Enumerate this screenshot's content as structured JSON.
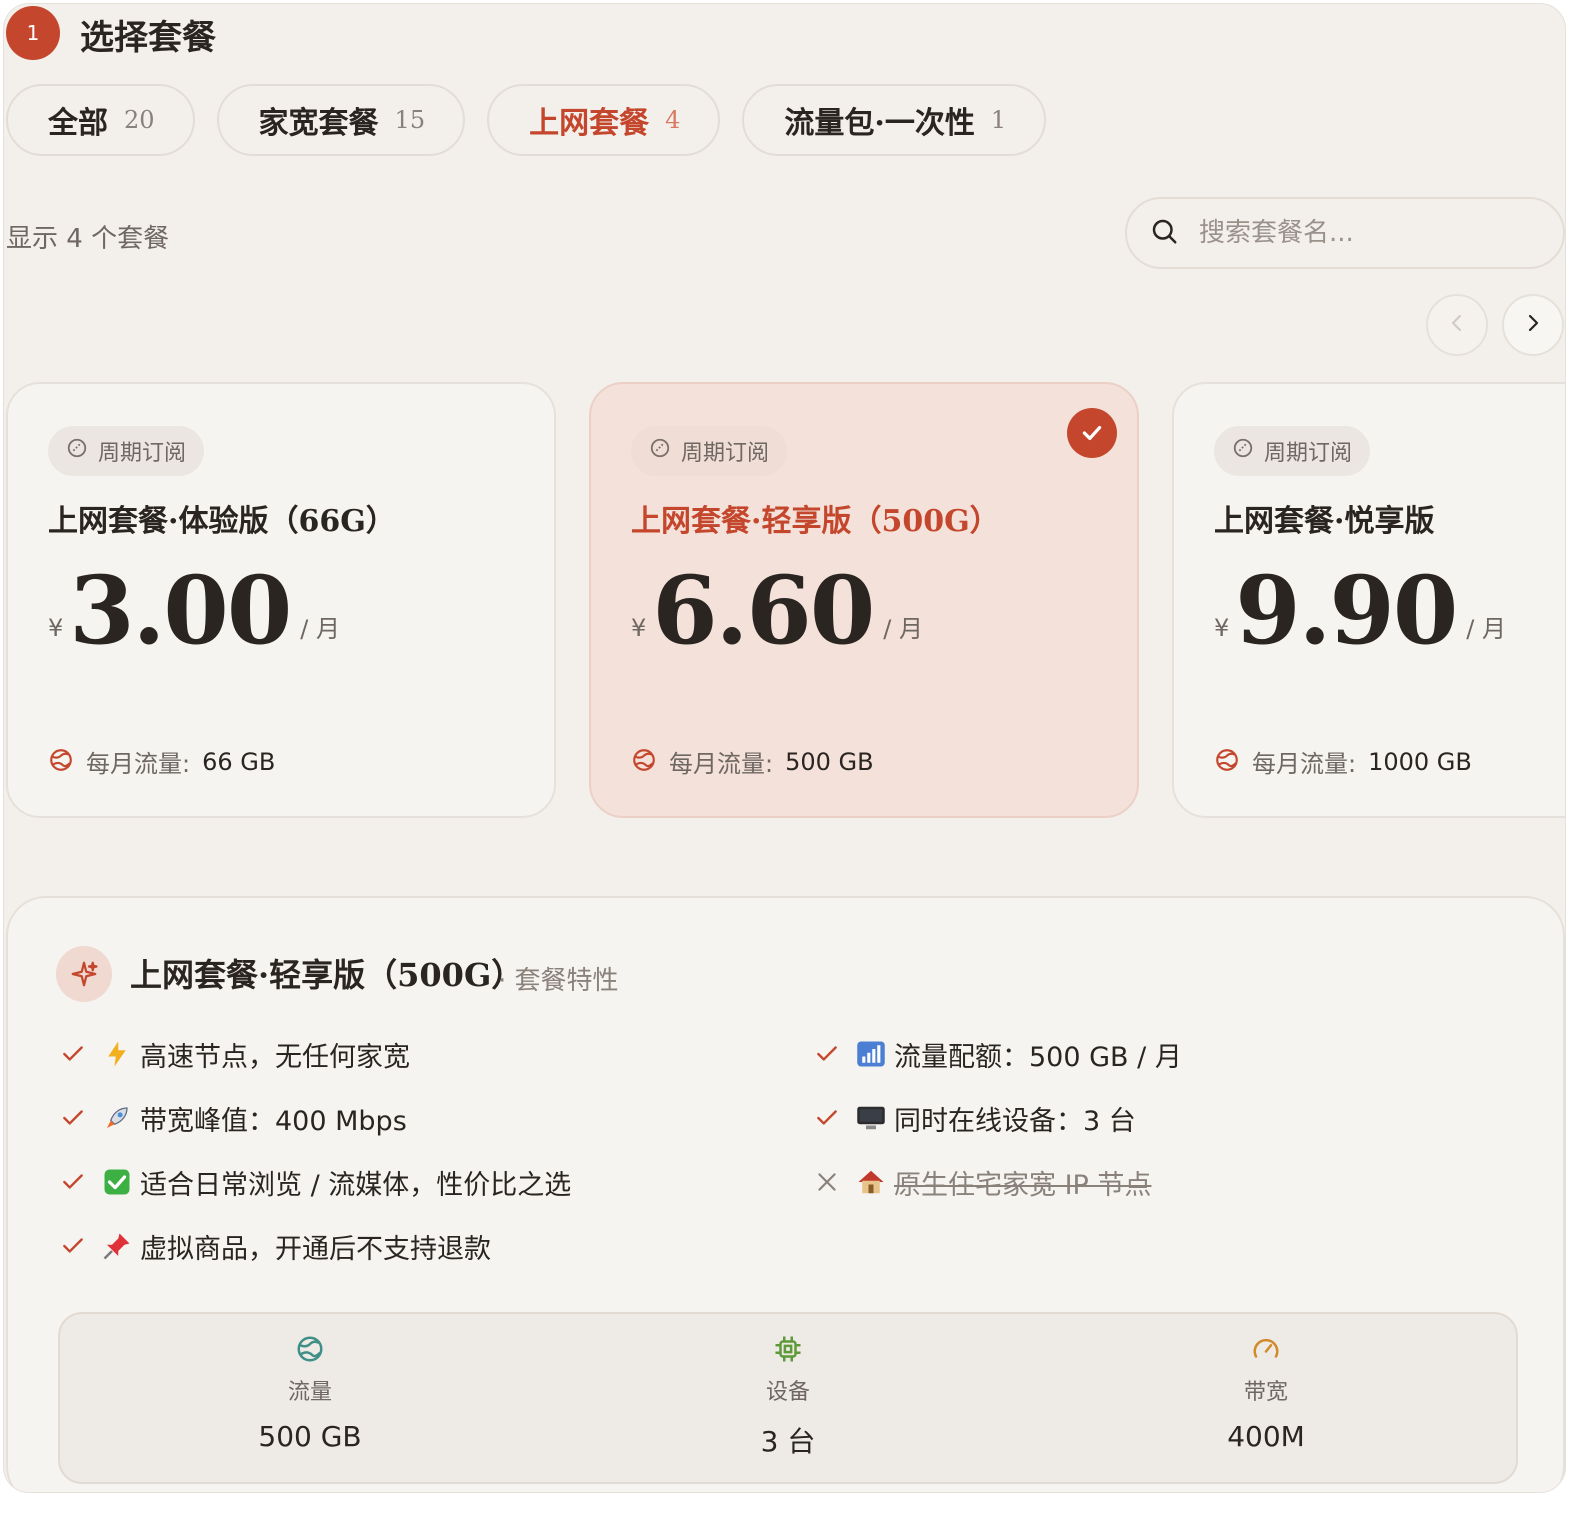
{
  "header": {
    "step_number": "1",
    "title": "选择套餐"
  },
  "tabs": [
    {
      "label": "全部",
      "count": "20",
      "active": false
    },
    {
      "label": "家宽套餐",
      "count": "15",
      "active": false
    },
    {
      "label": "上网套餐",
      "count": "4",
      "active": true
    },
    {
      "label": "流量包·一次性",
      "count": "1",
      "active": false
    }
  ],
  "listing": {
    "count_text": "显示 4 个套餐",
    "search_placeholder": "搜索套餐名..."
  },
  "plans": [
    {
      "tag": "周期订阅",
      "name": "上网套餐·体验版（66G）",
      "currency": "¥",
      "price": "3.00",
      "unit": "/ 月",
      "traffic_label": "每月流量:",
      "traffic_value": "66 GB",
      "selected": false
    },
    {
      "tag": "周期订阅",
      "name": "上网套餐·轻享版（500G）",
      "currency": "¥",
      "price": "6.60",
      "unit": "/ 月",
      "traffic_label": "每月流量:",
      "traffic_value": "500 GB",
      "selected": true
    },
    {
      "tag": "周期订阅",
      "name": "上网套餐·悦享版",
      "currency": "¥",
      "price": "9.90",
      "unit": "/ 月",
      "traffic_label": "每月流量:",
      "traffic_value": "1000 GB",
      "selected": false
    }
  ],
  "detail": {
    "title": "上网套餐·轻享版（500G）",
    "subtitle": "· 套餐特性",
    "features_left": [
      {
        "icon": "lightning-icon",
        "text": "高速节点，无任何家宽",
        "included": true
      },
      {
        "icon": "rocket-icon",
        "text": "带宽峰值：400 Mbps",
        "included": true
      },
      {
        "icon": "green-check-icon",
        "text": "适合日常浏览 / 流媒体，性价比之选",
        "included": true
      },
      {
        "icon": "pushpin-icon",
        "text": "虚拟商品，开通后不支持退款",
        "included": true
      }
    ],
    "features_right": [
      {
        "icon": "signal-bars-icon",
        "text": "流量配额：500 GB / 月",
        "included": true
      },
      {
        "icon": "monitor-icon",
        "text": "同时在线设备：3 台",
        "included": true
      },
      {
        "icon": "house-icon",
        "text": "原生住宅家宽 IP 节点",
        "included": false
      }
    ],
    "stats": [
      {
        "icon": "globe-icon",
        "label": "流量",
        "value": "500 GB"
      },
      {
        "icon": "chip-icon",
        "label": "设备",
        "value": "3 台"
      },
      {
        "icon": "gauge-icon",
        "label": "带宽",
        "value": "400M"
      }
    ]
  },
  "colors": {
    "accent": "#c4472d",
    "background": "#f3f0ec",
    "selected_card": "#f3e1da",
    "text": "#2b2522",
    "muted": "#6f6762"
  }
}
